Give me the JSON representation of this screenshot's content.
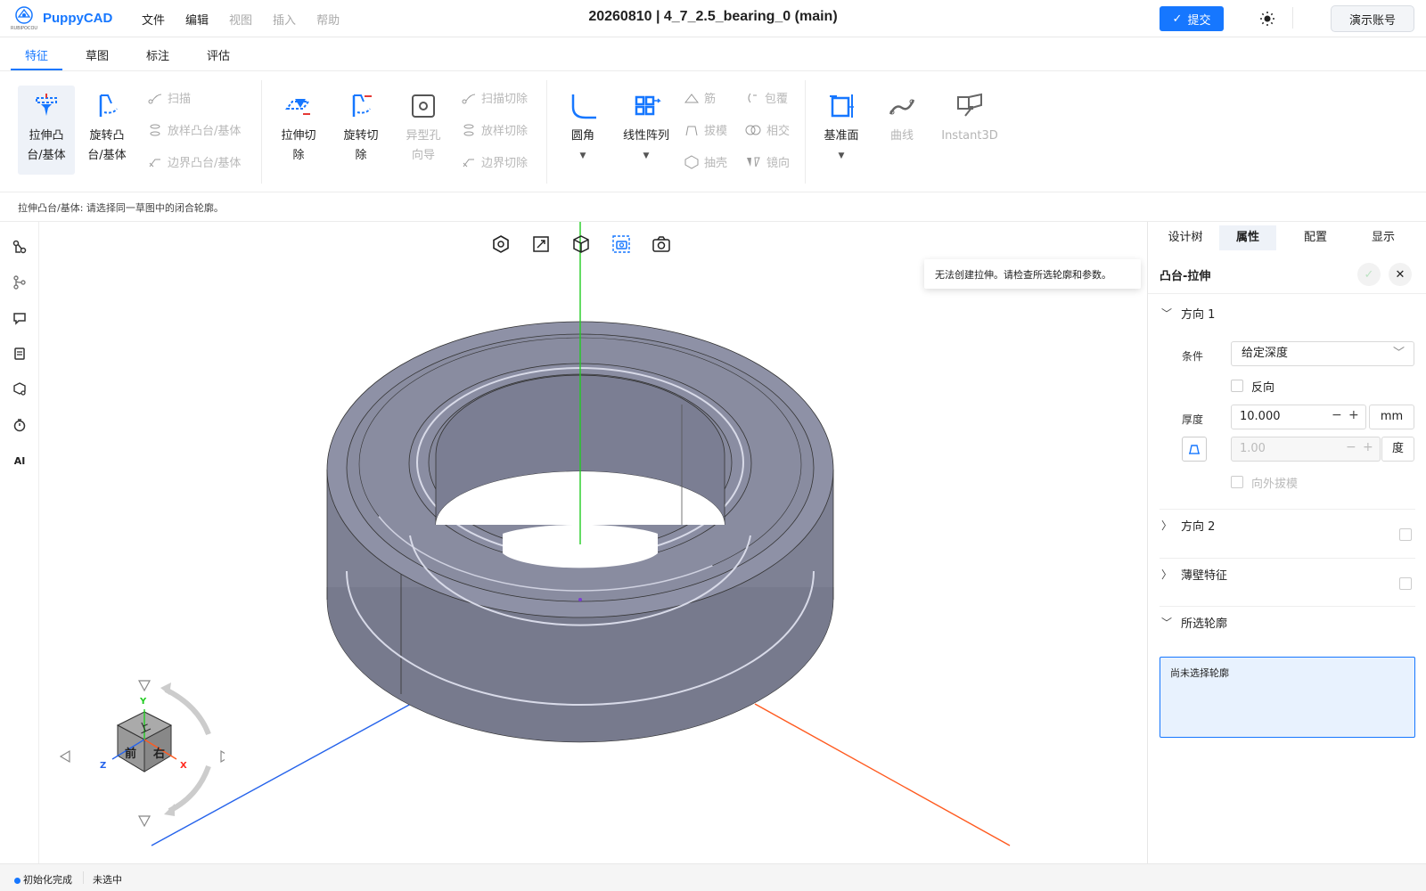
{
  "app": {
    "name": "PuppyCAD",
    "logo_sub": "RUBIPOCOU"
  },
  "menu": [
    "文件",
    "编辑",
    "视图",
    "插入",
    "帮助"
  ],
  "doc_title": "20260810 | 4_7_2.5_bearing_0  (main)",
  "submit_label": "提交",
  "account_label": "演示账号",
  "tabs": [
    "特征",
    "草图",
    "标注",
    "评估"
  ],
  "ribbon": {
    "extrude_boss": [
      "拉伸凸",
      "台/基体"
    ],
    "revolve_boss": [
      "旋转凸",
      "台/基体"
    ],
    "sweep": "扫描",
    "loft": "放样凸台/基体",
    "boundary": "边界凸台/基体",
    "extrude_cut": [
      "拉伸切",
      "除"
    ],
    "revolve_cut": [
      "旋转切",
      "除"
    ],
    "hole_wizard": [
      "异型孔",
      "向导"
    ],
    "sweep_cut": "扫描切除",
    "loft_cut": "放样切除",
    "boundary_cut": "边界切除",
    "fillet": "圆角",
    "linear_pattern": "线性阵列",
    "rib": "筋",
    "wrap": "包覆",
    "draft": "拔模",
    "intersect": "相交",
    "shell": "抽壳",
    "mirror": "镜向",
    "ref_plane": "基准面",
    "curve": "曲线",
    "instant3d": "Instant3D"
  },
  "hint": "拉伸凸台/基体: 请选择同一草图中的闭合轮廓。",
  "tooltip": "无法创建拉伸。请检查所选轮廓和参数。",
  "left_tools": {
    "ai_label": "AI"
  },
  "view_cube": {
    "top": "上",
    "front": "前",
    "right": "右",
    "axis_x": "X",
    "axis_y": "Y",
    "axis_z": "Z"
  },
  "panel": {
    "tabs": [
      "设计树",
      "属性",
      "配置",
      "显示"
    ],
    "title": "凸台-拉伸",
    "dir1": "方向 1",
    "condition_label": "条件",
    "condition_value": "给定深度",
    "reverse_label": "反向",
    "thickness_label": "厚度",
    "thickness_value": "10.000",
    "thickness_unit": "mm",
    "draft_value": "1.00",
    "draft_unit": "度",
    "draft_out_label": "向外拔模",
    "dir2": "方向 2",
    "thin": "薄壁特征",
    "profiles": "所选轮廓",
    "profiles_empty": "尚未选择轮廓"
  },
  "status": {
    "init": "初始化完成",
    "selection": "未选中"
  },
  "colors": {
    "accent": "#1677ff",
    "body": "#7e8194",
    "axis_y": "#22cc22",
    "axis_x": "#ff5a1f",
    "axis_z": "#2563eb"
  }
}
